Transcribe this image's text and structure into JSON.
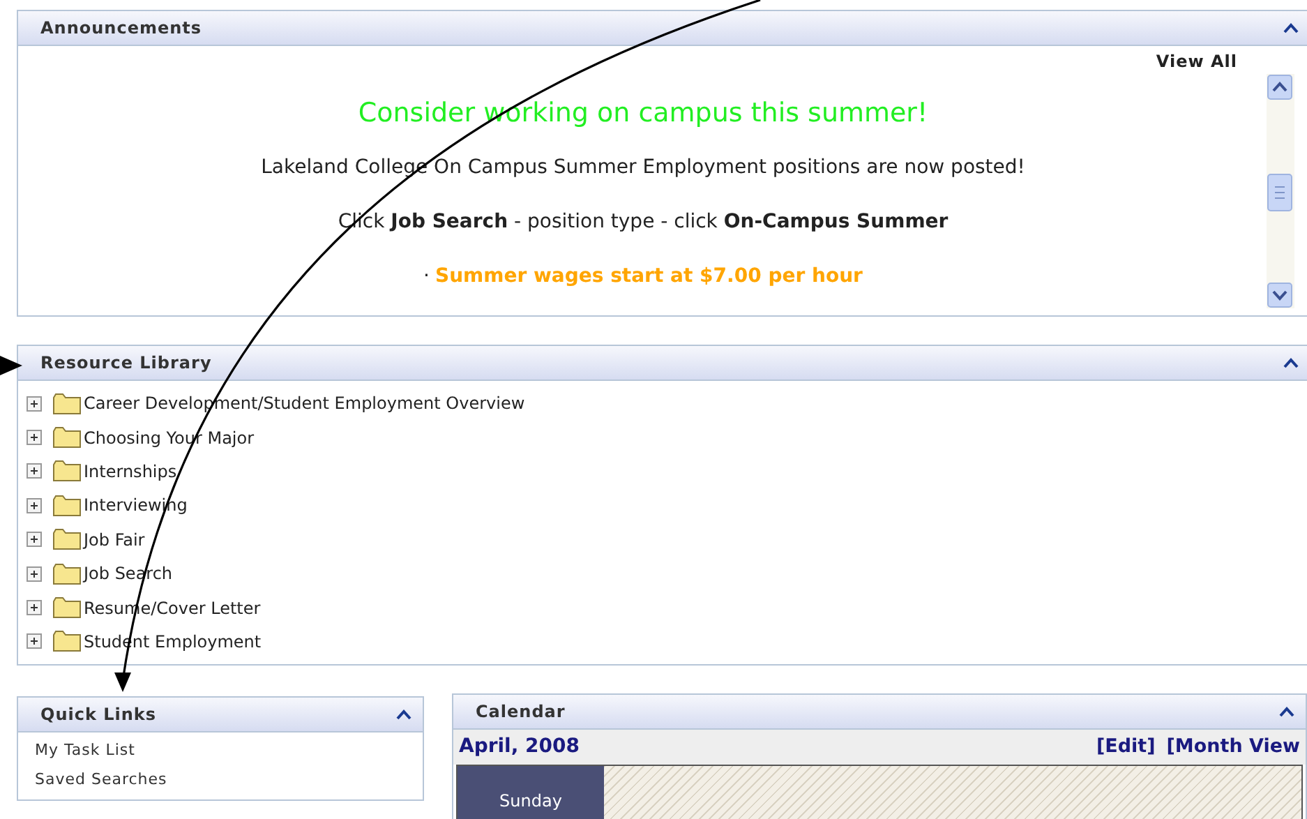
{
  "announcements": {
    "title": "Announcements",
    "view_all": "View All",
    "headline": "Consider working on campus this summer!",
    "paragraphs": [
      {
        "kind": "plain",
        "text": "Lakeland College On Campus Summer Employment positions are now posted!"
      },
      {
        "kind": "plain",
        "text": "Click **Job Search** - position type - click **On-Campus Summer**"
      },
      {
        "kind": "bullet",
        "bullet": "·",
        "text": "Summer wages start at $7.00 per hour",
        "color": "#ffa500"
      }
    ]
  },
  "resource_library": {
    "title": "Resource Library",
    "items": [
      {
        "label": "Career Development/Student Employment Overview",
        "expanded": false
      },
      {
        "label": "Choosing Your Major",
        "expanded": false
      },
      {
        "label": "Internships",
        "expanded": false
      },
      {
        "label": "Interviewing",
        "expanded": false
      },
      {
        "label": "Job Fair",
        "expanded": false
      },
      {
        "label": "Job Search",
        "expanded": false
      },
      {
        "label": "Resume/Cover Letter",
        "expanded": false
      },
      {
        "label": "Student Employment",
        "expanded": false
      }
    ]
  },
  "quick_links": {
    "title": "Quick Links",
    "links": [
      "My Task List",
      "Saved Searches"
    ]
  },
  "calendar": {
    "title": "Calendar",
    "month": "April, 2008",
    "actions": [
      "[Edit]",
      "[Month View"
    ],
    "day": "Sunday"
  }
}
